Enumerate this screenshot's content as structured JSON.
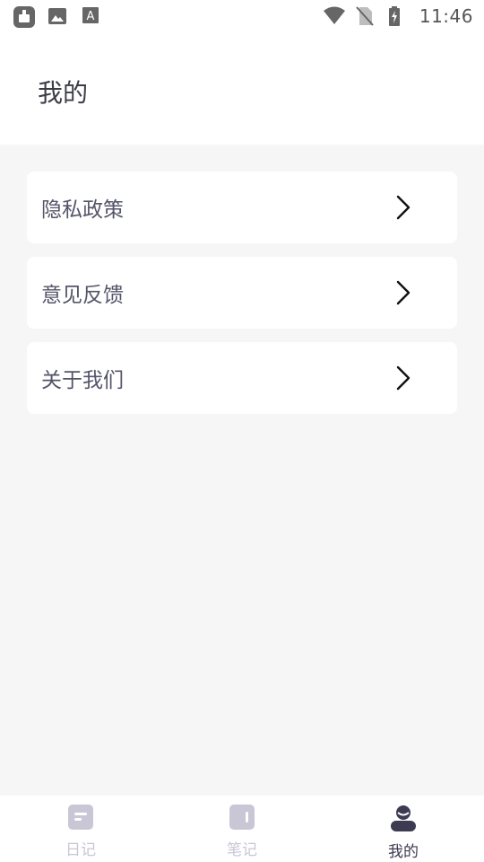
{
  "status_bar": {
    "time": "11:46",
    "left_icons": [
      "app-notification-icon",
      "image-icon",
      "text-icon"
    ],
    "right_icons": [
      "wifi-icon",
      "no-sim-icon",
      "battery-charging-icon"
    ]
  },
  "header": {
    "title": "我的"
  },
  "menu": {
    "items": [
      {
        "label": "隐私政策",
        "icon": "chevron-right-icon"
      },
      {
        "label": "意见反馈",
        "icon": "chevron-right-icon"
      },
      {
        "label": "关于我们",
        "icon": "chevron-right-icon"
      }
    ]
  },
  "bottom_nav": {
    "items": [
      {
        "label": "日记",
        "icon": "diary-icon",
        "active": false
      },
      {
        "label": "笔记",
        "icon": "notes-icon",
        "active": false
      },
      {
        "label": "我的",
        "icon": "profile-icon",
        "active": true
      }
    ]
  },
  "colors": {
    "background": "#f6f6f6",
    "card": "#ffffff",
    "text_primary": "#3c3c48",
    "nav_active": "#3c3b52",
    "nav_inactive": "#c9c6d6"
  }
}
